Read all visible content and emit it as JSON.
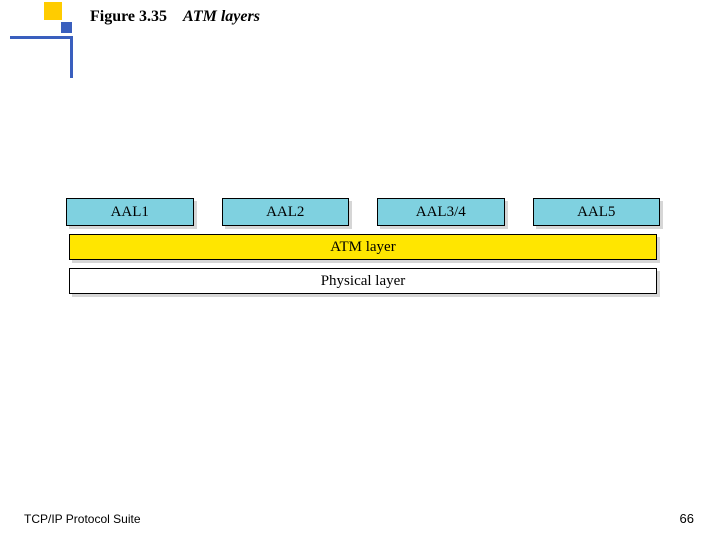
{
  "title": {
    "figure_number": "Figure 3.35",
    "caption": "ATM layers"
  },
  "layers": {
    "aal": [
      "AAL1",
      "AAL2",
      "AAL3/4",
      "AAL5"
    ],
    "atm": "ATM layer",
    "physical": "Physical layer"
  },
  "footer": {
    "source": "TCP/IP Protocol Suite",
    "page": "66"
  },
  "colors": {
    "aal": "#7fd1e0",
    "atm": "#ffe600",
    "accent": "#3a5fbe",
    "accent2": "#ffcc00"
  },
  "chart_data": {
    "type": "table",
    "title": "ATM layers",
    "rows": [
      [
        "AAL1",
        "AAL2",
        "AAL3/4",
        "AAL5"
      ],
      [
        "ATM layer"
      ],
      [
        "Physical layer"
      ]
    ]
  }
}
